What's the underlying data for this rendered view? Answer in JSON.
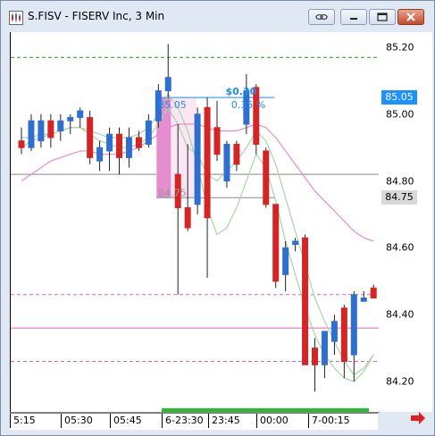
{
  "window": {
    "title": "S.FISV - FISERV Inc, 3 Min"
  },
  "icons": {
    "app": "chart-app-icon",
    "link": "link-icon",
    "minimize": "minimize-icon",
    "maximize": "maximize-icon",
    "close": "close-icon",
    "scroll_right": "right-arrow-icon"
  },
  "colors": {
    "up_candle": "#2e6fd0",
    "down_candle": "#d42424",
    "measure_box": "#e07cc8",
    "measure_text": "#1e8ee8",
    "ma_green": "#a8d4a8",
    "ma_pink": "#e98cc4",
    "green_level": "#1a9a1a",
    "pink_level": "#e060b8",
    "gray_level": "#888888",
    "price_badge_blue": "#1e90ff",
    "price_badge_gray": "#d8d8d8",
    "arrow_red": "#e02020"
  },
  "y_axis": {
    "ticks": [
      "85.20",
      "85.00",
      "84.80",
      "84.60",
      "84.40",
      "84.20"
    ],
    "badges": [
      {
        "text": "85.05",
        "value": 85.05,
        "style": "blue"
      },
      {
        "text": "84.75",
        "value": 84.75,
        "style": "gray"
      }
    ]
  },
  "x_axis": {
    "ticks": [
      "5:15",
      "05:30",
      "05:45",
      "6-23:30",
      "23:45",
      "00:00",
      "7-00:15"
    ]
  },
  "measure": {
    "change": "$0.30",
    "percent": "0.35 %",
    "start_label": "85.05",
    "end_label": "84.75"
  },
  "chart_data": {
    "type": "candlestick",
    "ylim": [
      84.13,
      85.3
    ],
    "candles": [
      {
        "o": 84.92,
        "h": 84.96,
        "l": 84.88,
        "c": 84.9
      },
      {
        "o": 84.9,
        "h": 85.0,
        "l": 84.89,
        "c": 84.98
      },
      {
        "o": 84.92,
        "h": 85.0,
        "l": 84.9,
        "c": 84.98
      },
      {
        "o": 84.98,
        "h": 85.0,
        "l": 84.9,
        "c": 84.93
      },
      {
        "o": 84.95,
        "h": 85.0,
        "l": 84.92,
        "c": 84.98
      },
      {
        "o": 84.98,
        "h": 85.0,
        "l": 84.94,
        "c": 84.99
      },
      {
        "o": 84.99,
        "h": 85.02,
        "l": 84.96,
        "c": 85.01
      },
      {
        "o": 84.99,
        "h": 85.01,
        "l": 84.85,
        "c": 84.87
      },
      {
        "o": 84.86,
        "h": 84.92,
        "l": 84.83,
        "c": 84.9
      },
      {
        "o": 84.89,
        "h": 84.96,
        "l": 84.83,
        "c": 84.94
      },
      {
        "o": 84.94,
        "h": 84.96,
        "l": 84.82,
        "c": 84.87
      },
      {
        "o": 84.87,
        "h": 84.96,
        "l": 84.84,
        "c": 84.93
      },
      {
        "o": 84.93,
        "h": 84.95,
        "l": 84.89,
        "c": 84.9
      },
      {
        "o": 84.91,
        "h": 85.0,
        "l": 84.9,
        "c": 84.98
      },
      {
        "o": 84.98,
        "h": 85.09,
        "l": 84.96,
        "c": 85.07
      },
      {
        "o": 85.07,
        "h": 85.21,
        "l": 85.05,
        "c": 85.11
      },
      {
        "o": 84.82,
        "h": 84.97,
        "l": 84.46,
        "c": 84.72
      },
      {
        "o": 84.72,
        "h": 84.91,
        "l": 84.65,
        "c": 84.66
      },
      {
        "o": 84.73,
        "h": 85.02,
        "l": 84.7,
        "c": 85.0
      },
      {
        "o": 85.02,
        "h": 85.05,
        "l": 84.51,
        "c": 84.69
      },
      {
        "o": 84.96,
        "h": 85.04,
        "l": 84.86,
        "c": 84.88
      },
      {
        "o": 84.8,
        "h": 84.92,
        "l": 84.78,
        "c": 84.91
      },
      {
        "o": 84.91,
        "h": 84.92,
        "l": 84.83,
        "c": 84.85
      },
      {
        "o": 84.97,
        "h": 85.12,
        "l": 84.94,
        "c": 85.07
      },
      {
        "o": 85.08,
        "h": 85.09,
        "l": 84.88,
        "c": 84.91
      },
      {
        "o": 84.89,
        "h": 84.9,
        "l": 84.72,
        "c": 84.73
      },
      {
        "o": 84.73,
        "h": 84.73,
        "l": 84.48,
        "c": 84.5
      },
      {
        "o": 84.52,
        "h": 84.62,
        "l": 84.47,
        "c": 84.6
      },
      {
        "o": 84.61,
        "h": 84.63,
        "l": 84.59,
        "c": 84.62
      },
      {
        "o": 84.63,
        "h": 84.64,
        "l": 84.27,
        "c": 84.25
      },
      {
        "o": 84.3,
        "h": 84.33,
        "l": 84.17,
        "c": 84.25
      },
      {
        "o": 84.25,
        "h": 84.32,
        "l": 84.21,
        "c": 84.35
      },
      {
        "o": 84.32,
        "h": 84.4,
        "l": 84.28,
        "c": 84.38
      },
      {
        "o": 84.42,
        "h": 84.43,
        "l": 84.21,
        "c": 84.26
      },
      {
        "o": 84.28,
        "h": 84.47,
        "l": 84.2,
        "c": 84.46
      },
      {
        "o": 84.44,
        "h": 84.47,
        "l": 84.44,
        "c": 84.45
      },
      {
        "o": 84.48,
        "h": 84.49,
        "l": 84.45,
        "c": 84.45
      }
    ],
    "levels": [
      {
        "value": 85.17,
        "color": "#1a9a1a",
        "style": "dashed"
      },
      {
        "value": 84.82,
        "color": "#888888",
        "style": "solid"
      },
      {
        "value": 84.46,
        "color": "#e060b8",
        "style": "dashed"
      },
      {
        "value": 84.36,
        "color": "#e060b8",
        "style": "solid"
      },
      {
        "value": 84.26,
        "color": "#e060b8",
        "style": "dashed"
      }
    ],
    "moving_averages": [
      {
        "color": "#a8d4a8",
        "values": [
          84.9,
          84.92,
          84.93,
          84.94,
          84.95,
          84.96,
          84.96,
          84.94,
          84.92,
          84.91,
          84.9,
          84.9,
          84.91,
          84.93,
          84.97,
          85.02,
          84.97,
          84.9,
          84.88,
          84.82,
          84.8,
          84.83,
          84.86,
          84.9,
          84.95,
          84.92,
          84.85,
          84.75,
          84.65,
          84.55,
          84.45,
          84.38,
          84.32,
          84.26,
          84.22,
          84.24,
          84.28
        ]
      },
      {
        "color": "#a8d4a8",
        "values": [
          84.93,
          84.93,
          84.94,
          84.94,
          84.95,
          84.96,
          84.96,
          84.95,
          84.94,
          84.93,
          84.93,
          84.93,
          84.94,
          84.96,
          85.0,
          85.06,
          85.02,
          84.95,
          84.85,
          84.72,
          84.64,
          84.66,
          84.72,
          84.8,
          84.88,
          84.84,
          84.74,
          84.62,
          84.52,
          84.42,
          84.34,
          84.28,
          84.24,
          84.21,
          84.2,
          84.23,
          84.28
        ]
      },
      {
        "color": "#e98cc4",
        "values": [
          84.8,
          84.82,
          84.84,
          84.86,
          84.87,
          84.88,
          84.89,
          84.89,
          84.88,
          84.88,
          84.88,
          84.89,
          84.9,
          84.92,
          84.94,
          84.96,
          84.97,
          84.97,
          84.97,
          84.96,
          84.95,
          84.95,
          84.95,
          84.96,
          84.97,
          84.96,
          84.93,
          84.89,
          84.85,
          84.81,
          84.77,
          84.74,
          84.71,
          84.68,
          84.65,
          84.63,
          84.62
        ]
      }
    ],
    "measure_range": {
      "start_index": 14,
      "end_index": 17,
      "high": 85.05,
      "low": 84.75
    }
  }
}
